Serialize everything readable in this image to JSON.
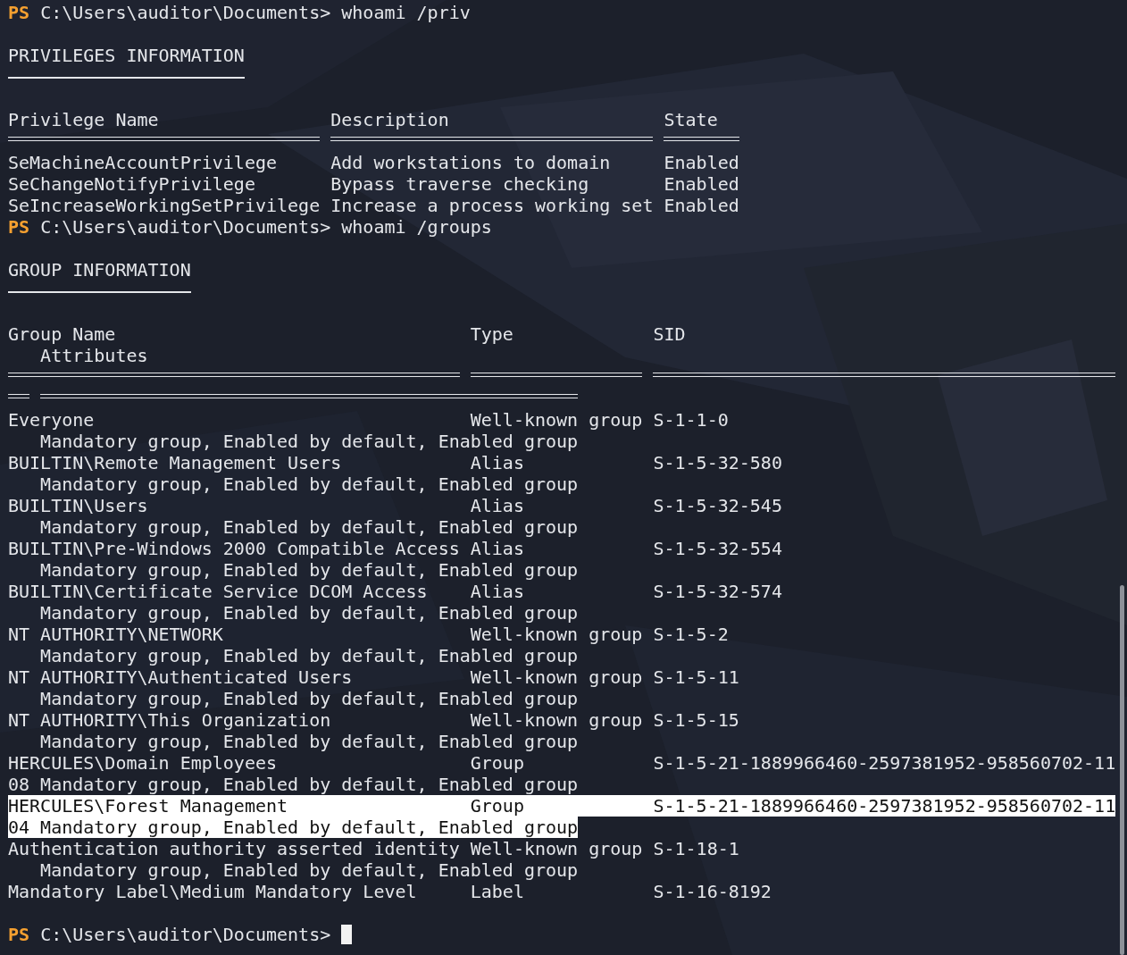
{
  "prompt_priv": {
    "label": "PS",
    "path": "C:\\Users\\auditor\\Documents>",
    "command": "whoami /priv"
  },
  "privileges": {
    "heading": "PRIVILEGES INFORMATION",
    "columns": [
      "Privilege Name",
      "Description",
      "State"
    ],
    "rows": [
      {
        "name": "SeMachineAccountPrivilege",
        "description": "Add workstations to domain",
        "state": "Enabled"
      },
      {
        "name": "SeChangeNotifyPrivilege",
        "description": "Bypass traverse checking",
        "state": "Enabled"
      },
      {
        "name": "SeIncreaseWorkingSetPrivilege",
        "description": "Increase a process working set",
        "state": "Enabled"
      }
    ]
  },
  "prompt_groups": {
    "label": "PS",
    "path": "C:\\Users\\auditor\\Documents>",
    "command": "whoami /groups"
  },
  "groups": {
    "heading": "GROUP INFORMATION",
    "columns": [
      "Group Name",
      "Type",
      "SID"
    ],
    "attributes_column": "Attributes",
    "rows": [
      {
        "name": "Everyone",
        "type": "Well-known group",
        "sid": "S-1-1-0",
        "attributes": "Mandatory group, Enabled by default, Enabled group",
        "selected": false
      },
      {
        "name": "BUILTIN\\Remote Management Users",
        "type": "Alias",
        "sid": "S-1-5-32-580",
        "attributes": "Mandatory group, Enabled by default, Enabled group",
        "selected": false
      },
      {
        "name": "BUILTIN\\Users",
        "type": "Alias",
        "sid": "S-1-5-32-545",
        "attributes": "Mandatory group, Enabled by default, Enabled group",
        "selected": false
      },
      {
        "name": "BUILTIN\\Pre-Windows 2000 Compatible Access",
        "type": "Alias",
        "sid": "S-1-5-32-554",
        "attributes": "Mandatory group, Enabled by default, Enabled group",
        "selected": false
      },
      {
        "name": "BUILTIN\\Certificate Service DCOM Access",
        "type": "Alias",
        "sid": "S-1-5-32-574",
        "attributes": "Mandatory group, Enabled by default, Enabled group",
        "selected": false
      },
      {
        "name": "NT AUTHORITY\\NETWORK",
        "type": "Well-known group",
        "sid": "S-1-5-2",
        "attributes": "Mandatory group, Enabled by default, Enabled group",
        "selected": false
      },
      {
        "name": "NT AUTHORITY\\Authenticated Users",
        "type": "Well-known group",
        "sid": "S-1-5-11",
        "attributes": "Mandatory group, Enabled by default, Enabled group",
        "selected": false
      },
      {
        "name": "NT AUTHORITY\\This Organization",
        "type": "Well-known group",
        "sid": "S-1-5-15",
        "attributes": "Mandatory group, Enabled by default, Enabled group",
        "selected": false
      },
      {
        "name": "HERCULES\\Domain Employees",
        "type": "Group",
        "sid": "S-1-5-21-1889966460-2597381952-958560702-11",
        "sid_wrap": "08",
        "attributes": "Mandatory group, Enabled by default, Enabled group",
        "selected": false
      },
      {
        "name": "HERCULES\\Forest Management",
        "type": "Group",
        "sid": "S-1-5-21-1889966460-2597381952-958560702-11",
        "sid_wrap": "04",
        "attributes": "Mandatory group, Enabled by default, Enabled group",
        "selected": true
      },
      {
        "name": "Authentication authority asserted identity",
        "type": "Well-known group",
        "sid": "S-1-18-1",
        "attributes": "Mandatory group, Enabled by default, Enabled group",
        "selected": false
      },
      {
        "name": "Mandatory Label\\Medium Mandatory Level",
        "type": "Label",
        "sid": "S-1-16-8192",
        "selected": false
      }
    ]
  },
  "prompt_final": {
    "label": "PS",
    "path": "C:\\Users\\auditor\\Documents>"
  }
}
